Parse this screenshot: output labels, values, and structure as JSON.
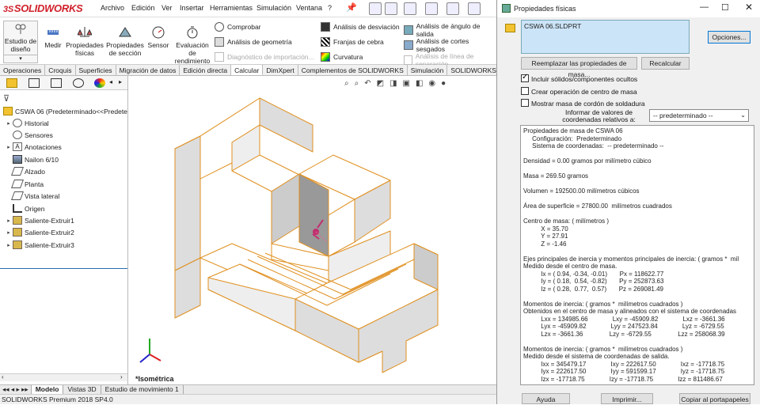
{
  "app": {
    "logo_prefix": "3S",
    "logo_text": "SOLIDWORKS",
    "menus": [
      "Archivo",
      "Edición",
      "Ver",
      "Insertar",
      "Herramientas",
      "Simulación",
      "Ventana",
      "?"
    ]
  },
  "commands": {
    "study_design": "Estudio de diseño",
    "measure": "Medir",
    "properties": "Propiedades físicas",
    "section_props": "Propiedades de sección",
    "sensor": "Sensor",
    "perf_eval": "Evaluación de rendimiento",
    "check": "Comprobar",
    "geom_analysis": "Análisis de geometría",
    "import_diag": "Diagnóstico de importación...",
    "deviation": "Análisis de desviación",
    "zebra": "Franjas de cebra",
    "curvature": "Curvatura",
    "draft": "Análisis de ángulo de salida",
    "undercut": "Análisis de cortes sesgados",
    "parting": "Análisis de línea de separación"
  },
  "tabs": [
    "Operaciones",
    "Croquis",
    "Superficies",
    "Migración de datos",
    "Edición directa",
    "Calcular",
    "DimXpert",
    "Complementos de SOLIDWORKS",
    "Simulación",
    "SOLIDWORKS"
  ],
  "active_tab": "Calcular",
  "tree": {
    "root": "CSWA 06  (Predeterminado<<Predete",
    "items": [
      "Historial",
      "Sensores",
      "Anotaciones",
      "Nailon 6/10",
      "Alzado",
      "Planta",
      "Vista lateral",
      "Origen",
      "Saliente-Extruir1",
      "Saliente-Extruir2",
      "Saliente-Extruir3"
    ]
  },
  "viewport": {
    "view_label": "*Isométrica"
  },
  "bottom_tabs": [
    "Modelo",
    "Vistas 3D",
    "Estudio de movimiento 1"
  ],
  "status": "SOLIDWORKS Premium 2018 SP4.0",
  "dialog": {
    "title": "Propiedades físicas",
    "selection": "CSWA 06.SLDPRT",
    "options": "Opciones...",
    "override": "Reemplazar las propiedades de masa...",
    "recalc": "Recalcular",
    "include_hidden": "Incluir sólidos/componentes ocultos",
    "create_com": "Crear operación de centro de masa",
    "show_weld": "Mostrar masa de cordón de soldadura",
    "report_label_1": "Informar de valores de",
    "report_label_2": "coordenadas relativos a:",
    "coord_value": "-- predeterminado --",
    "help": "Ayuda",
    "print": "Imprimir...",
    "copy": "Copiar al portapapeles",
    "results": [
      "Propiedades de masa de CSWA 06",
      "     Configuración:  Predeterminado",
      "     Sistema de coordenadas:  -- predeterminado --",
      "",
      "Densidad = 0.00 gramos por milímetro cúbico",
      "",
      "Masa = 269.50 gramos",
      "",
      "Volumen = 192500.00 milímetros cúbicos",
      "",
      "Área de superficie = 27800.00  milímetros cuadrados",
      "",
      "Centro de masa: ( milímetros )",
      "          X = 35.70",
      "          Y = 27.91",
      "          Z = -1.46",
      "",
      "Ejes principales de inercia y momentos principales de inercia: ( gramos *  mil",
      "Medido desde el centro de masa.",
      "          Ix = ( 0.94, -0.34, -0.01)       Px = 118622.77",
      "          Iy = ( 0.18,  0.54, -0.82)       Py = 252873.63",
      "          Iz = ( 0.28,  0.77,  0.57)       Pz = 269081.49",
      "",
      "Momentos de inercia: ( gramos *  milímetros cuadrados )",
      "Obtenidos en el centro de masa y alineados con el sistema de coordenadas",
      "          Lxx = 134985.66              Lxy = -45909.82              Lxz = -3661.36",
      "          Lyx = -45909.82              Lyy = 247523.84              Lyz = -6729.55",
      "          Lzx = -3661.36               Lzy = -6729.55               Lzz = 258068.39",
      "",
      "Momentos de inercia: ( gramos *  milímetros cuadrados )",
      "Medido desde el sistema de coordenadas de salida.",
      "          Ixx = 345479.17              Ixy = 222617.50              Ixz = -17718.75",
      "          Iyx = 222617.50              Iyy = 591599.17              Iyz = -17718.75",
      "          Izx = -17718.75              Izy = -17718.75              Izz = 811486.67"
    ]
  }
}
